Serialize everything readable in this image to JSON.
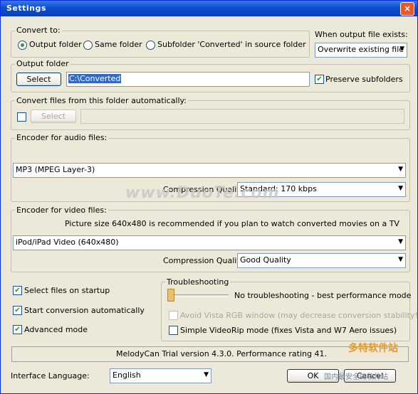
{
  "window": {
    "title": "Settings",
    "close": "×"
  },
  "convert_to": {
    "label": "Convert to:",
    "options": [
      {
        "label": "Output folder",
        "selected": true
      },
      {
        "label": "Same folder",
        "selected": false
      },
      {
        "label": "Subfolder 'Converted' in source folder",
        "selected": false
      }
    ]
  },
  "when_exists": {
    "label": "When output file exists:",
    "value": "Overwrite existing file"
  },
  "output_folder": {
    "label": "Output folder",
    "select_button": "Select",
    "path": "C:\\Converted",
    "preserve_label": "Preserve subfolders",
    "preserve_checked": true
  },
  "auto_convert": {
    "label": "Convert files from this folder automatically:",
    "select_button": "Select",
    "checked": false,
    "path": ""
  },
  "audio": {
    "label": "Encoder for audio files:",
    "encoder": "MP3 (MPEG Layer-3)",
    "quality_label": "Compression Quality",
    "quality": "Standard: 170 kbps"
  },
  "video": {
    "label": "Encoder for video files:",
    "hint": "Picture size 640x480 is recommended if you plan to watch converted movies on a TV",
    "encoder": "iPod/iPad Video (640x480)",
    "quality_label": "Compression Quality",
    "quality": "Good Quality"
  },
  "options": [
    {
      "label": "Select files on startup",
      "checked": true
    },
    {
      "label": "Start conversion automatically",
      "checked": true
    },
    {
      "label": "Advanced mode",
      "checked": true
    }
  ],
  "troubleshooting": {
    "label": "Troubleshooting",
    "level_text": "No troubleshooting - best performance mode",
    "level": 0,
    "avoid_label": "Avoid Vista RGB window (may decrease conversion stability!)",
    "avoid_checked": false,
    "simple_label": "Simple VideoRip mode (fixes Vista and W7 Aero issues)",
    "simple_checked": false
  },
  "status": "MelodyCan Trial version 4.3.0. Performance rating 41.",
  "language": {
    "label": "Interface Language:",
    "value": "English"
  },
  "buttons": {
    "ok": "OK",
    "cancel": "Cancel"
  },
  "watermark": {
    "main": "www.DuoTe.com",
    "brand": "多特软件站",
    "sub": "国内最安全的软件站"
  },
  "colors": {
    "titlebar": "#0a4fd0",
    "face": "#ece9d8",
    "check": "#21a121"
  }
}
